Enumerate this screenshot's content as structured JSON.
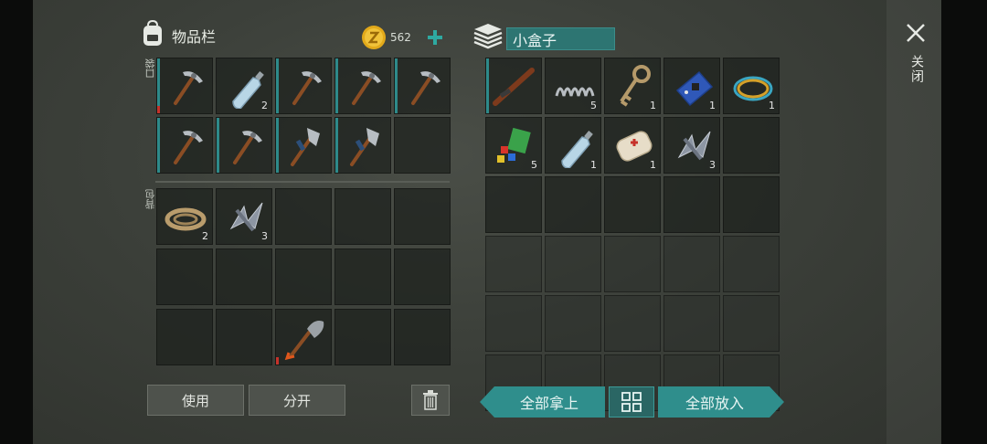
{
  "inventory": {
    "title": "物品栏",
    "coins": "562",
    "pocket_label": "口袋",
    "backpack_label": "背包"
  },
  "container": {
    "name": "小盒子"
  },
  "close_label": "关闭",
  "buttons": {
    "use": "使用",
    "split": "分开",
    "take_all": "全部拿上",
    "put_all": "全部放入"
  },
  "pocket_slots": [
    {
      "item": "pickaxe",
      "accent": true,
      "durability_red": true,
      "count": ""
    },
    {
      "item": "water-bottle",
      "accent": false,
      "count": "2"
    },
    {
      "item": "pickaxe",
      "accent": true,
      "count": ""
    },
    {
      "item": "pickaxe",
      "accent": true,
      "count": ""
    },
    {
      "item": "pickaxe",
      "accent": true,
      "count": ""
    },
    {
      "item": "pickaxe",
      "accent": true,
      "count": ""
    },
    {
      "item": "pickaxe",
      "accent": true,
      "count": ""
    },
    {
      "item": "hatchet",
      "accent": true,
      "count": ""
    },
    {
      "item": "hatchet",
      "accent": true,
      "count": ""
    },
    {
      "item": "empty",
      "accent": false,
      "count": ""
    }
  ],
  "backpack_slots": [
    {
      "item": "rope",
      "count": "2"
    },
    {
      "item": "metal-scrap",
      "count": "3"
    },
    {
      "item": "empty",
      "count": ""
    },
    {
      "item": "empty",
      "count": ""
    },
    {
      "item": "empty",
      "count": ""
    },
    {
      "item": "empty",
      "count": ""
    },
    {
      "item": "empty",
      "count": ""
    },
    {
      "item": "empty",
      "count": ""
    },
    {
      "item": "empty",
      "count": ""
    },
    {
      "item": "empty",
      "count": ""
    },
    {
      "item": "empty",
      "count": ""
    },
    {
      "item": "empty",
      "count": ""
    },
    {
      "item": "shovel",
      "count": "",
      "durability_red": true
    },
    {
      "item": "empty",
      "count": ""
    },
    {
      "item": "empty",
      "count": ""
    }
  ],
  "box_slots": [
    {
      "item": "shotgun",
      "count": "",
      "accent": true
    },
    {
      "item": "spring",
      "count": "5"
    },
    {
      "item": "key",
      "count": "1"
    },
    {
      "item": "circuit-board",
      "count": "1"
    },
    {
      "item": "wire",
      "count": "1"
    },
    {
      "item": "sticky-notes",
      "count": "5"
    },
    {
      "item": "water-bottle",
      "count": "1"
    },
    {
      "item": "bandage",
      "count": "1"
    },
    {
      "item": "metal-scrap",
      "count": "3"
    },
    {
      "item": "empty",
      "count": ""
    }
  ],
  "colors": {
    "accent": "#2e8a8a",
    "teal_button": "#2f8e8c",
    "durability_red": "#c6322a",
    "coin": "#e2a91a"
  }
}
